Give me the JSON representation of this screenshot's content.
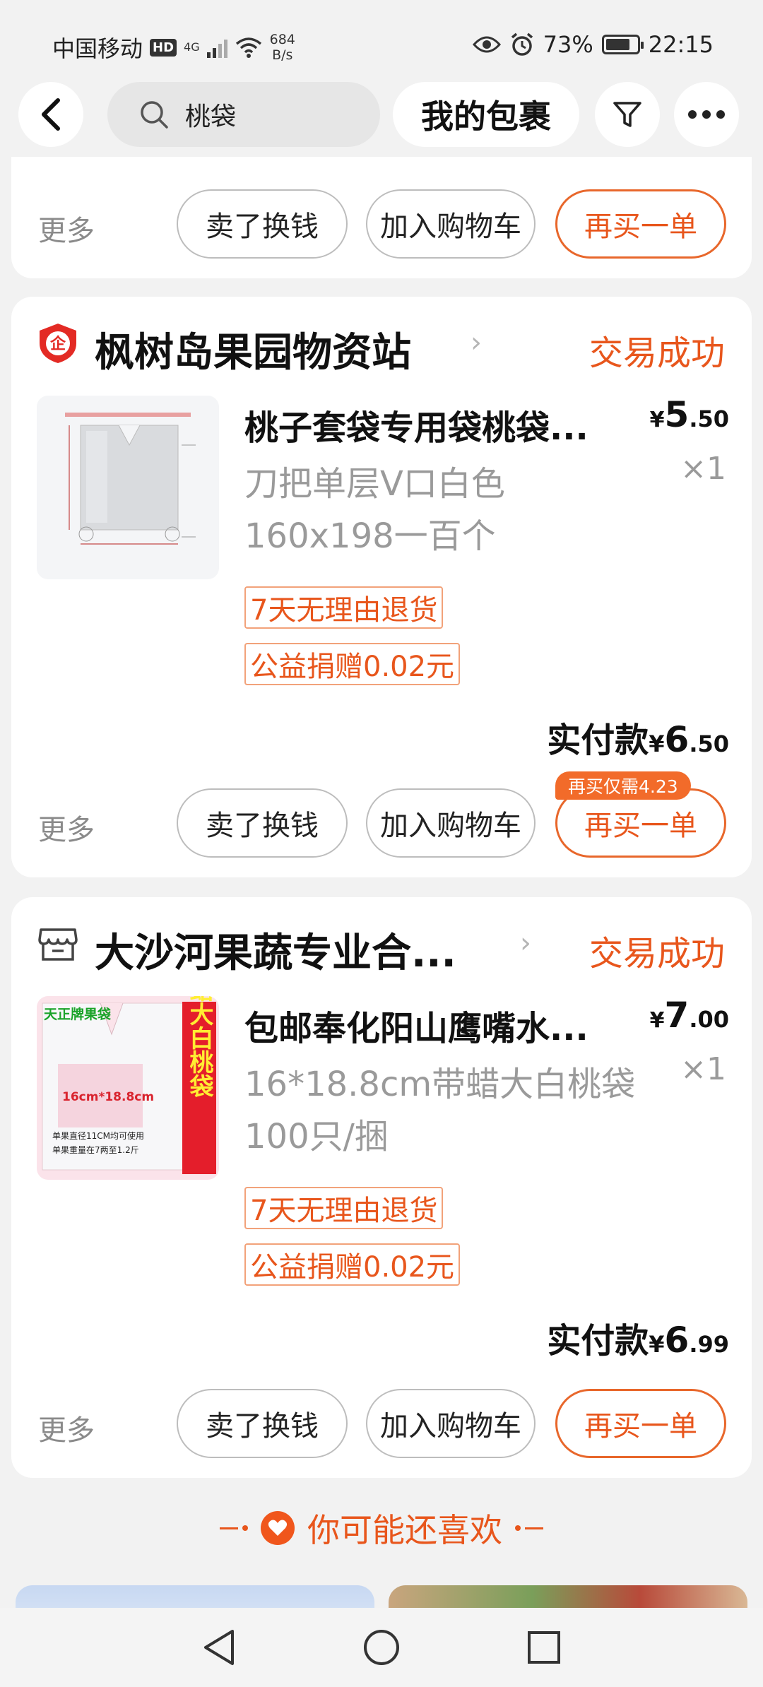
{
  "status_bar": {
    "carrier": "中国移动",
    "hd_badge": "HD",
    "network": "4G",
    "speed_value": "684",
    "speed_unit": "B/s",
    "battery": "73%",
    "time": "22:15"
  },
  "top_bar": {
    "search_text": "桃袋",
    "packages_label": "我的包裹"
  },
  "actions": {
    "more": "更多",
    "sell": "卖了换钱",
    "add_cart": "加入购物车",
    "rebuy": "再买一单"
  },
  "orders": [
    {
      "shop_name": "枫树岛果园物资站",
      "status": "交易成功",
      "title": "桃子套袋专用袋桃袋...",
      "spec": "刀把单层V口白色160x198一百个",
      "price_currency": "¥",
      "price_int": "5",
      "price_dec": ".50",
      "qty": "×1",
      "tags": [
        "7天无理由退货",
        "公益捐赠0.02元"
      ],
      "paid_label": "实付款",
      "paid_currency": "¥",
      "paid_int": "6",
      "paid_dec": ".50",
      "rebuy_badge": "再买仅需4.23"
    },
    {
      "shop_name": "大沙河果蔬专业合...",
      "status": "交易成功",
      "title": "包邮奉化阳山鹰嘴水...",
      "spec": "16*18.8cm带蜡大白桃袋100只/捆",
      "price_currency": "¥",
      "price_int": "7",
      "price_dec": ".00",
      "qty": "×1",
      "tags": [
        "7天无理由退货",
        "公益捐赠0.02元"
      ],
      "paid_label": "实付款",
      "paid_currency": "¥",
      "paid_int": "6",
      "paid_dec": ".99",
      "thumb_brand": "天正牌果袋",
      "thumb_vertical": "带蜡大白桃袋",
      "thumb_size": "16cm*18.8cm",
      "thumb_note1": "单果直径11CM均可使用",
      "thumb_note2": "单果重量在7两至1.2斤"
    }
  ],
  "recommend": {
    "label": "你可能还喜欢"
  },
  "colors": {
    "accent": "#e8561c",
    "background": "#f2f2f2",
    "card": "#ffffff"
  }
}
